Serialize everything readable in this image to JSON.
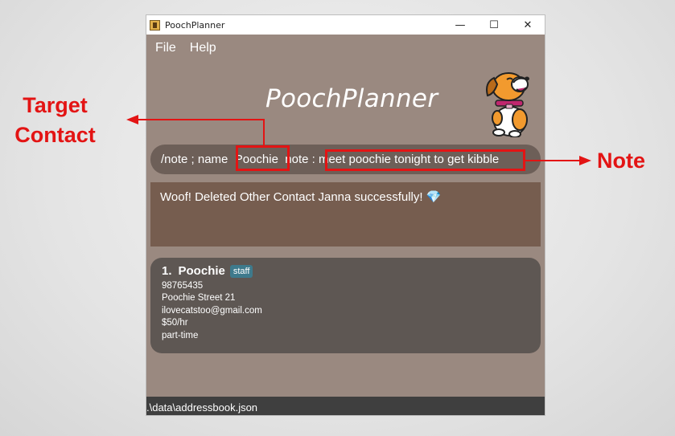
{
  "window": {
    "title": "PoochPlanner",
    "controls": {
      "minimize": "—",
      "maximize": "☐",
      "close": "✕"
    }
  },
  "menu": [
    {
      "label": "File"
    },
    {
      "label": "Help"
    }
  ],
  "app_title": "PoochPlanner",
  "command_box": {
    "value": "/note ; name  Poochie  note : meet poochie tonight to get kibble"
  },
  "result_display": {
    "text": "Woof! Deleted Other Contact Janna successfully! 💎"
  },
  "contacts": [
    {
      "index": "1.",
      "name": "Poochie",
      "tag": "staff",
      "phone": "98765435",
      "address": "Poochie Street 21",
      "email": "ilovecatstoo@gmail.com",
      "salary": "$50/hr",
      "employment": "part-time"
    }
  ],
  "status_bar": {
    "path": ".\\data\\addressbook.json"
  },
  "annotations": {
    "target_contact_label": "Target\nContact",
    "note_label": "Note",
    "color": "#e31414"
  },
  "icons": {
    "app_icon": "pooch-app-icon",
    "mascot": "dog-mascot"
  }
}
